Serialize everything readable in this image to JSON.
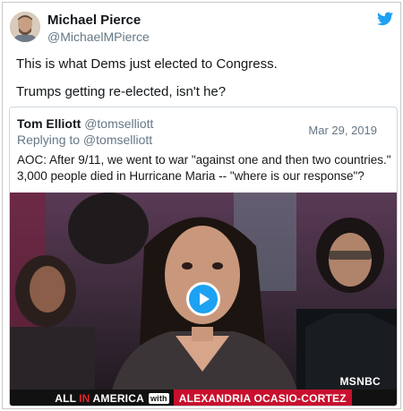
{
  "tweet": {
    "author_name": "Michael Pierce",
    "author_handle": "@MichaelMPierce",
    "lines": [
      "This is what Dems just elected to Congress.",
      "Trumps getting re-elected, isn't he?"
    ]
  },
  "quoted": {
    "author_name": "Tom Elliott",
    "author_handle": "@tomselliott",
    "replying_to": "Replying to @tomselliott",
    "date": "Mar 29, 2019",
    "text": "AOC: After 9/11, we went to war \"against one and then two countries.\" 3,000 people died in Hurricane Maria -- \"where is our response\"?"
  },
  "video": {
    "network": "MSNBC",
    "banner_show_a": "ALL",
    "banner_show_b": "IN",
    "banner_show_c": "AMERICA",
    "banner_with": "with",
    "banner_guest": "ALEXANDRIA OCASIO-CORTEZ"
  },
  "colors": {
    "twitter_blue": "#1da1f2",
    "banner_red": "#c8102e"
  },
  "icons": [
    "twitter-bird-icon",
    "play-icon"
  ]
}
